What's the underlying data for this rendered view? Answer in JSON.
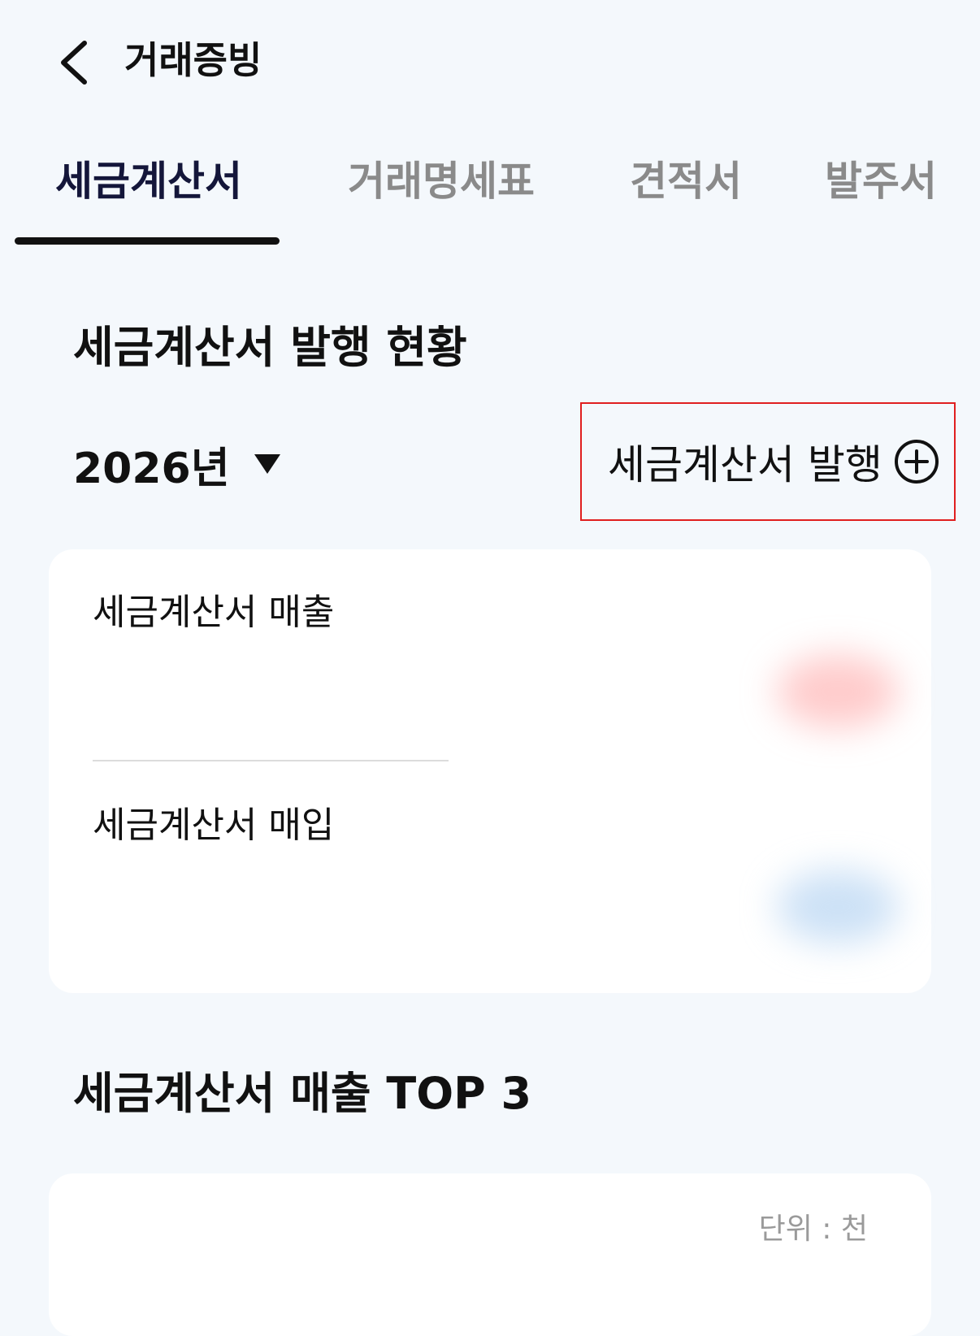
{
  "header": {
    "back_icon": "chevron-left-icon",
    "title": "거래증빙"
  },
  "tabs": [
    {
      "label": "세금계산서",
      "active": true
    },
    {
      "label": "거래명세표",
      "active": false
    },
    {
      "label": "견적서",
      "active": false
    },
    {
      "label": "발주서",
      "active": false
    }
  ],
  "status_section": {
    "title": "세금계산서 발행 현황",
    "year": "2026년",
    "dropdown_icon": "caret-down-icon",
    "issue_button": {
      "label": "세금계산서 발행",
      "icon": "plus-circle-icon"
    },
    "summary_card": {
      "sales_label": "세금계산서 매출",
      "purchase_label": "세금계산서 매입"
    }
  },
  "top3_section": {
    "title": "세금계산서 매출 TOP 3",
    "unit_label": "단위 : 천"
  },
  "colors": {
    "background": "#f4f8fc",
    "active_tab": "#14163a",
    "inactive_tab": "#8a8a8a",
    "highlight_border": "#e01f1f",
    "card": "#ffffff"
  }
}
